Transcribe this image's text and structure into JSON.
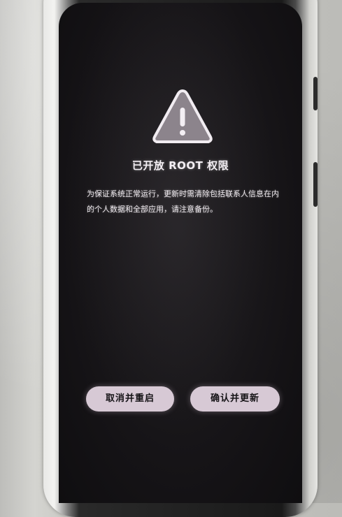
{
  "dialog": {
    "icon": "warning-triangle-icon",
    "title": "已开放 ROOT 权限",
    "message": "为保证系统正常运行，更新时需清除包括联系人信息在内的个人数据和全部应用，请注意备份。"
  },
  "buttons": {
    "cancel_label": "取消并重启",
    "confirm_label": "确认并更新"
  },
  "colors": {
    "screen_background": "#141215",
    "button_background": "#d7c9d5",
    "text": "#f4eff4"
  }
}
